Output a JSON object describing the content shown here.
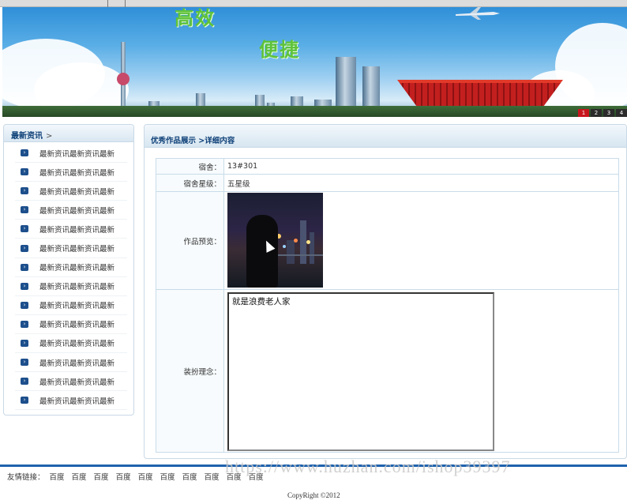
{
  "banner": {
    "slogan_1": "高效",
    "slogan_2": "便捷",
    "slides": [
      "1",
      "2",
      "3",
      "4"
    ]
  },
  "sidebar": {
    "title": "最新资讯",
    "arrow": ">",
    "items": [
      "最新资讯最新资讯最新",
      "最新资讯最新资讯最新",
      "最新资讯最新资讯最新",
      "最新资讯最新资讯最新",
      "最新资讯最新资讯最新",
      "最新资讯最新资讯最新",
      "最新资讯最新资讯最新",
      "最新资讯最新资讯最新",
      "最新资讯最新资讯最新",
      "最新资讯最新资讯最新",
      "最新资讯最新资讯最新",
      "最新资讯最新资讯最新",
      "最新资讯最新资讯最新",
      "最新资讯最新资讯最新"
    ]
  },
  "main": {
    "breadcrumb": "优秀作品展示 >详细内容",
    "fields": {
      "dorm_label": "宿舍：",
      "dorm_value": "13#301",
      "rating_label": "宿舍星级：",
      "rating_value": "五星级",
      "preview_label": "作品预览：",
      "concept_label": "装扮理念：",
      "concept_value": "就是浪费老人家"
    }
  },
  "footer": {
    "links_label": "友情链接：",
    "links": [
      "百度",
      "百度",
      "百度",
      "百度",
      "百度",
      "百度",
      "百度",
      "百度",
      "百度",
      "百度"
    ],
    "copyright": "CopyRight ©2012",
    "watermark": "https://www.huzhan.com/ishop39397"
  },
  "colors": {
    "accent": "#0d3f77",
    "footer_line": "#1f62ad",
    "slogan": "#5ec23a",
    "active_slide": "#c8161d"
  }
}
